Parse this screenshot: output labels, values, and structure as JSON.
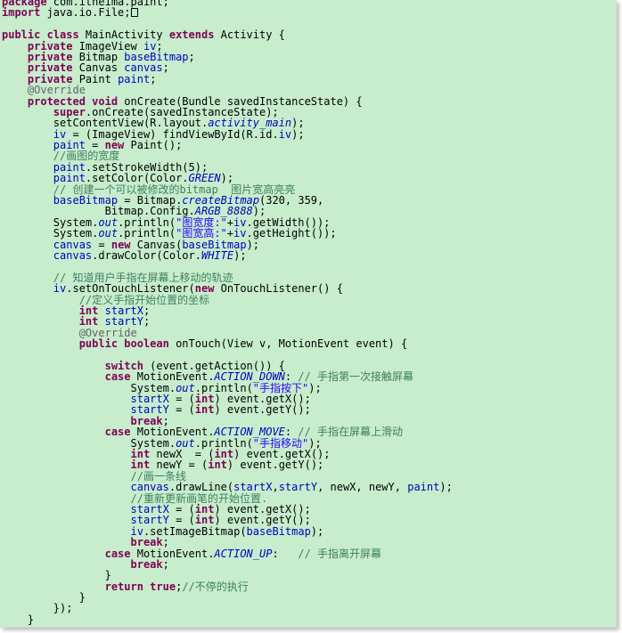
{
  "colors": {
    "background": "#c7edcc",
    "keyword": "#7f0055",
    "field": "#0000c0",
    "string": "#2a00ff",
    "comment": "#3f7f5f",
    "annotation": "#646464"
  },
  "lines": [
    [
      {
        "t": "kw",
        "v": "package"
      },
      {
        "t": "",
        "v": " com.itheima.paint;"
      }
    ],
    [
      {
        "t": "kw",
        "v": "import"
      },
      {
        "t": "",
        "v": " java.io.File;"
      },
      {
        "t": "cursor",
        "v": ""
      }
    ],
    [],
    [
      {
        "t": "kw",
        "v": "public class"
      },
      {
        "t": "",
        "v": " MainActivity "
      },
      {
        "t": "kw",
        "v": "extends"
      },
      {
        "t": "",
        "v": " Activity {"
      }
    ],
    [
      {
        "t": "",
        "v": "    "
      },
      {
        "t": "kw",
        "v": "private"
      },
      {
        "t": "",
        "v": " ImageView "
      },
      {
        "t": "field",
        "v": "iv"
      },
      {
        "t": "",
        "v": ";"
      }
    ],
    [
      {
        "t": "",
        "v": "    "
      },
      {
        "t": "kw",
        "v": "private"
      },
      {
        "t": "",
        "v": " Bitmap "
      },
      {
        "t": "field",
        "v": "baseBitmap"
      },
      {
        "t": "",
        "v": ";"
      }
    ],
    [
      {
        "t": "",
        "v": "    "
      },
      {
        "t": "kw",
        "v": "private"
      },
      {
        "t": "",
        "v": " Canvas "
      },
      {
        "t": "field",
        "v": "canvas"
      },
      {
        "t": "",
        "v": ";"
      }
    ],
    [
      {
        "t": "",
        "v": "    "
      },
      {
        "t": "kw",
        "v": "private"
      },
      {
        "t": "",
        "v": " Paint "
      },
      {
        "t": "field",
        "v": "paint"
      },
      {
        "t": "",
        "v": ";"
      }
    ],
    [
      {
        "t": "",
        "v": "    "
      },
      {
        "t": "ann",
        "v": "@Override"
      }
    ],
    [
      {
        "t": "",
        "v": "    "
      },
      {
        "t": "kw",
        "v": "protected void"
      },
      {
        "t": "",
        "v": " onCreate(Bundle savedInstanceState) {"
      }
    ],
    [
      {
        "t": "",
        "v": "        "
      },
      {
        "t": "kw",
        "v": "super"
      },
      {
        "t": "",
        "v": ".onCreate(savedInstanceState);"
      }
    ],
    [
      {
        "t": "",
        "v": "        setContentView(R.layout."
      },
      {
        "t": "static",
        "v": "activity_main"
      },
      {
        "t": "",
        "v": ");"
      }
    ],
    [
      {
        "t": "",
        "v": "        "
      },
      {
        "t": "field",
        "v": "iv"
      },
      {
        "t": "",
        "v": " = (ImageView) findViewById(R.id."
      },
      {
        "t": "field",
        "v": "iv"
      },
      {
        "t": "",
        "v": ");"
      }
    ],
    [
      {
        "t": "",
        "v": "        "
      },
      {
        "t": "field",
        "v": "paint"
      },
      {
        "t": "",
        "v": " = "
      },
      {
        "t": "kw",
        "v": "new"
      },
      {
        "t": "",
        "v": " Paint();"
      }
    ],
    [
      {
        "t": "",
        "v": "        "
      },
      {
        "t": "cmt",
        "v": "//画图的宽度"
      }
    ],
    [
      {
        "t": "",
        "v": "        "
      },
      {
        "t": "field",
        "v": "paint"
      },
      {
        "t": "",
        "v": ".setStrokeWidth(5);"
      }
    ],
    [
      {
        "t": "",
        "v": "        "
      },
      {
        "t": "field",
        "v": "paint"
      },
      {
        "t": "",
        "v": ".setColor(Color."
      },
      {
        "t": "static",
        "v": "GREEN"
      },
      {
        "t": "",
        "v": ");"
      }
    ],
    [
      {
        "t": "",
        "v": "        "
      },
      {
        "t": "cmt",
        "v": "// 创建一个可以被修改的bitmap  图片宽高亮亮"
      }
    ],
    [
      {
        "t": "",
        "v": "        "
      },
      {
        "t": "field",
        "v": "baseBitmap"
      },
      {
        "t": "",
        "v": " = Bitmap."
      },
      {
        "t": "static",
        "v": "createBitmap"
      },
      {
        "t": "",
        "v": "(320, 359,"
      }
    ],
    [
      {
        "t": "",
        "v": "                Bitmap.Config."
      },
      {
        "t": "static",
        "v": "ARGB_8888"
      },
      {
        "t": "",
        "v": ");"
      }
    ],
    [
      {
        "t": "",
        "v": "        System."
      },
      {
        "t": "static",
        "v": "out"
      },
      {
        "t": "",
        "v": ".println("
      },
      {
        "t": "str",
        "v": "\"图宽度:\""
      },
      {
        "t": "",
        "v": "+"
      },
      {
        "t": "field",
        "v": "iv"
      },
      {
        "t": "",
        "v": ".getWidth());"
      }
    ],
    [
      {
        "t": "",
        "v": "        System."
      },
      {
        "t": "static",
        "v": "out"
      },
      {
        "t": "",
        "v": ".println("
      },
      {
        "t": "str",
        "v": "\"图宽高:\""
      },
      {
        "t": "",
        "v": "+"
      },
      {
        "t": "field",
        "v": "iv"
      },
      {
        "t": "",
        "v": ".getHeight());"
      }
    ],
    [
      {
        "t": "",
        "v": "        "
      },
      {
        "t": "field",
        "v": "canvas"
      },
      {
        "t": "",
        "v": " = "
      },
      {
        "t": "kw",
        "v": "new"
      },
      {
        "t": "",
        "v": " Canvas("
      },
      {
        "t": "field",
        "v": "baseBitmap"
      },
      {
        "t": "",
        "v": ");"
      }
    ],
    [
      {
        "t": "",
        "v": "        "
      },
      {
        "t": "field",
        "v": "canvas"
      },
      {
        "t": "",
        "v": ".drawColor(Color."
      },
      {
        "t": "static",
        "v": "WHITE"
      },
      {
        "t": "",
        "v": ");"
      }
    ],
    [],
    [
      {
        "t": "",
        "v": "        "
      },
      {
        "t": "cmt",
        "v": "// 知道用户手指在屏幕上移动的轨迹"
      }
    ],
    [
      {
        "t": "",
        "v": "        "
      },
      {
        "t": "field",
        "v": "iv"
      },
      {
        "t": "",
        "v": ".setOnTouchListener("
      },
      {
        "t": "kw",
        "v": "new"
      },
      {
        "t": "",
        "v": " OnTouchListener() {"
      }
    ],
    [
      {
        "t": "",
        "v": "            "
      },
      {
        "t": "cmt",
        "v": "//定义手指开始位置的坐标"
      }
    ],
    [
      {
        "t": "",
        "v": "            "
      },
      {
        "t": "kw",
        "v": "int"
      },
      {
        "t": "",
        "v": " "
      },
      {
        "t": "field",
        "v": "startX"
      },
      {
        "t": "",
        "v": ";"
      }
    ],
    [
      {
        "t": "",
        "v": "            "
      },
      {
        "t": "kw",
        "v": "int"
      },
      {
        "t": "",
        "v": " "
      },
      {
        "t": "field",
        "v": "startY"
      },
      {
        "t": "",
        "v": ";"
      }
    ],
    [
      {
        "t": "",
        "v": "            "
      },
      {
        "t": "ann",
        "v": "@Override"
      }
    ],
    [
      {
        "t": "",
        "v": "            "
      },
      {
        "t": "kw",
        "v": "public boolean"
      },
      {
        "t": "",
        "v": " onTouch(View v, MotionEvent event) {"
      }
    ],
    [],
    [
      {
        "t": "",
        "v": "                "
      },
      {
        "t": "kw",
        "v": "switch"
      },
      {
        "t": "",
        "v": " (event.getAction()) {"
      }
    ],
    [
      {
        "t": "",
        "v": "                "
      },
      {
        "t": "kw",
        "v": "case"
      },
      {
        "t": "",
        "v": " MotionEvent."
      },
      {
        "t": "static",
        "v": "ACTION_DOWN"
      },
      {
        "t": "",
        "v": ": "
      },
      {
        "t": "cmt",
        "v": "// 手指第一次接触屏幕"
      }
    ],
    [
      {
        "t": "",
        "v": "                    System."
      },
      {
        "t": "static",
        "v": "out"
      },
      {
        "t": "",
        "v": ".println("
      },
      {
        "t": "str",
        "v": "\"手指按下\""
      },
      {
        "t": "",
        "v": ");"
      }
    ],
    [
      {
        "t": "",
        "v": "                    "
      },
      {
        "t": "field",
        "v": "startX"
      },
      {
        "t": "",
        "v": " = ("
      },
      {
        "t": "kw",
        "v": "int"
      },
      {
        "t": "",
        "v": ") event.getX();"
      }
    ],
    [
      {
        "t": "",
        "v": "                    "
      },
      {
        "t": "field",
        "v": "startY"
      },
      {
        "t": "",
        "v": " = ("
      },
      {
        "t": "kw",
        "v": "int"
      },
      {
        "t": "",
        "v": ") event.getY();"
      }
    ],
    [
      {
        "t": "",
        "v": "                    "
      },
      {
        "t": "kw",
        "v": "break"
      },
      {
        "t": "",
        "v": ";"
      }
    ],
    [
      {
        "t": "",
        "v": "                "
      },
      {
        "t": "kw",
        "v": "case"
      },
      {
        "t": "",
        "v": " MotionEvent."
      },
      {
        "t": "static",
        "v": "ACTION_MOVE"
      },
      {
        "t": "",
        "v": ": "
      },
      {
        "t": "cmt",
        "v": "// 手指在屏幕上滑动"
      }
    ],
    [
      {
        "t": "",
        "v": "                    System."
      },
      {
        "t": "static",
        "v": "out"
      },
      {
        "t": "",
        "v": ".println("
      },
      {
        "t": "str",
        "v": "\"手指移动\""
      },
      {
        "t": "",
        "v": ");"
      }
    ],
    [
      {
        "t": "",
        "v": "                    "
      },
      {
        "t": "kw",
        "v": "int"
      },
      {
        "t": "",
        "v": " newX  = ("
      },
      {
        "t": "kw",
        "v": "int"
      },
      {
        "t": "",
        "v": ") event.getX();"
      }
    ],
    [
      {
        "t": "",
        "v": "                    "
      },
      {
        "t": "kw",
        "v": "int"
      },
      {
        "t": "",
        "v": " newY = ("
      },
      {
        "t": "kw",
        "v": "int"
      },
      {
        "t": "",
        "v": ") event.getY();"
      }
    ],
    [
      {
        "t": "",
        "v": "                    "
      },
      {
        "t": "cmt",
        "v": "//画一条线"
      }
    ],
    [
      {
        "t": "",
        "v": "                    "
      },
      {
        "t": "field",
        "v": "canvas"
      },
      {
        "t": "",
        "v": ".drawLine("
      },
      {
        "t": "field",
        "v": "startX"
      },
      {
        "t": "",
        "v": ","
      },
      {
        "t": "field",
        "v": "startY"
      },
      {
        "t": "",
        "v": ", newX, newY, "
      },
      {
        "t": "field",
        "v": "paint"
      },
      {
        "t": "",
        "v": ");"
      }
    ],
    [
      {
        "t": "",
        "v": "                    "
      },
      {
        "t": "cmt",
        "v": "//重新更新画笔的开始位置."
      }
    ],
    [
      {
        "t": "",
        "v": "                    "
      },
      {
        "t": "field",
        "v": "startX"
      },
      {
        "t": "",
        "v": " = ("
      },
      {
        "t": "kw",
        "v": "int"
      },
      {
        "t": "",
        "v": ") event.getX();"
      }
    ],
    [
      {
        "t": "",
        "v": "                    "
      },
      {
        "t": "field",
        "v": "startY"
      },
      {
        "t": "",
        "v": " = ("
      },
      {
        "t": "kw",
        "v": "int"
      },
      {
        "t": "",
        "v": ") event.getY();"
      }
    ],
    [
      {
        "t": "",
        "v": "                    "
      },
      {
        "t": "field",
        "v": "iv"
      },
      {
        "t": "",
        "v": ".setImageBitmap("
      },
      {
        "t": "field",
        "v": "baseBitmap"
      },
      {
        "t": "",
        "v": ");"
      }
    ],
    [
      {
        "t": "",
        "v": "                    "
      },
      {
        "t": "kw",
        "v": "break"
      },
      {
        "t": "",
        "v": ";"
      }
    ],
    [
      {
        "t": "",
        "v": "                "
      },
      {
        "t": "kw",
        "v": "case"
      },
      {
        "t": "",
        "v": " MotionEvent."
      },
      {
        "t": "static",
        "v": "ACTION_UP"
      },
      {
        "t": "",
        "v": ":   "
      },
      {
        "t": "cmt",
        "v": "// 手指离开屏幕"
      }
    ],
    [
      {
        "t": "",
        "v": "                    "
      },
      {
        "t": "kw",
        "v": "break"
      },
      {
        "t": "",
        "v": ";"
      }
    ],
    [
      {
        "t": "",
        "v": "                }"
      }
    ],
    [
      {
        "t": "",
        "v": "                "
      },
      {
        "t": "kw",
        "v": "return true"
      },
      {
        "t": "",
        "v": ";"
      },
      {
        "t": "cmt",
        "v": "//不停的执行"
      }
    ],
    [
      {
        "t": "",
        "v": "            }"
      }
    ],
    [
      {
        "t": "",
        "v": "        });"
      }
    ],
    [
      {
        "t": "",
        "v": "    }"
      }
    ]
  ]
}
